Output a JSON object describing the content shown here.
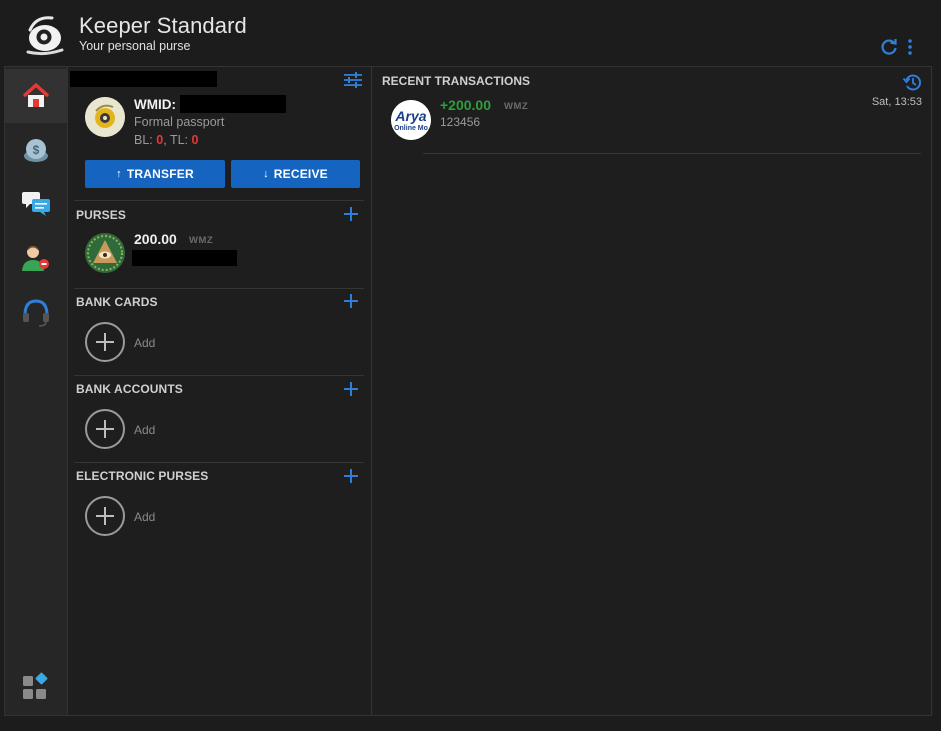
{
  "header": {
    "title": "Keeper Standard",
    "subtitle": "Your personal purse",
    "icons": {
      "logo": "keeper-logo",
      "refresh": "refresh-icon",
      "menu": "more-vert-icon"
    }
  },
  "nav": {
    "items": [
      {
        "icon": "home-icon",
        "active": true
      },
      {
        "icon": "dollar-coin-icon",
        "active": false
      },
      {
        "icon": "chat-icon",
        "active": false
      },
      {
        "icon": "contacts-icon",
        "active": false
      },
      {
        "icon": "headset-icon",
        "active": false
      }
    ],
    "bottom_icon": "apps-grid-icon"
  },
  "account": {
    "wmid_label": "WMID:",
    "passport": "Formal passport",
    "bl_label": "BL:",
    "bl_value": "0",
    "tl_label": "TL:",
    "tl_value": "0",
    "filter_icon": "tune-icon"
  },
  "actions": {
    "transfer": "TRANSFER",
    "receive": "RECEIVE"
  },
  "sections": {
    "purses": {
      "title": "PURSES",
      "items": [
        {
          "amount": "200.00",
          "currency": "WMZ"
        }
      ]
    },
    "bank_cards": {
      "title": "BANK CARDS",
      "add_label": "Add"
    },
    "bank_accounts": {
      "title": "BANK ACCOUNTS",
      "add_label": "Add"
    },
    "electronic_purses": {
      "title": "ELECTRONIC PURSES",
      "add_label": "Add"
    }
  },
  "transactions": {
    "title": "RECENT TRANSACTIONS",
    "items": [
      {
        "logo_text": "Arya",
        "logo_sub": "Online Mo",
        "amount": "+200.00",
        "currency": "WMZ",
        "description": "123456",
        "time": "Sat, 13:53"
      }
    ]
  },
  "colors": {
    "accent": "#1565c0",
    "positive": "#2e9e3c",
    "negative": "#e53935",
    "background": "#1c1c1c"
  }
}
